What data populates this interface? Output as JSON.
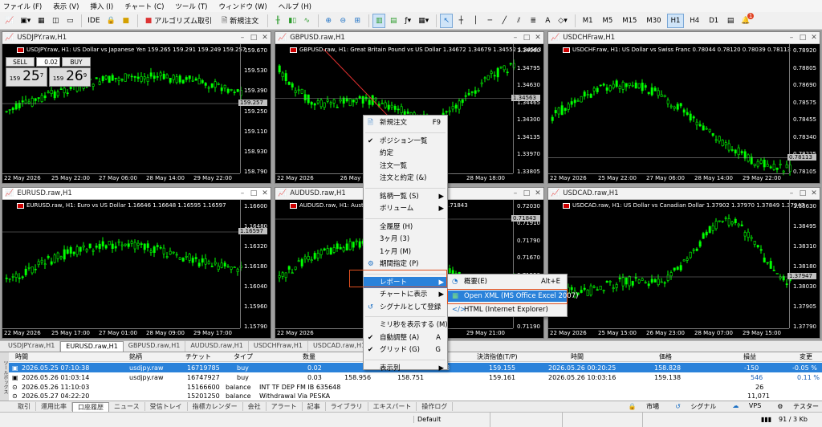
{
  "menu": [
    "ファイル (F)",
    "表示 (V)",
    "挿入 (I)",
    "チャート (C)",
    "ツール (T)",
    "ウィンドウ (W)",
    "ヘルプ (H)"
  ],
  "toolbar": {
    "algo_label": "アルゴリズム取引",
    "neworder_label": "新規注文",
    "ide_label": "IDE",
    "timeframes": [
      "M1",
      "M5",
      "M15",
      "M30",
      "H1",
      "H4",
      "D1"
    ],
    "active_timeframe": "H1",
    "notification_count": "1"
  },
  "charts": [
    {
      "title": "USDJPY.raw,H1",
      "info": "USDJPY.raw, H1:  US Dollar vs Japanese Yen  159.265 159.291 159.249 159.257",
      "prices": [
        "159.670",
        "159.530",
        "159.390",
        "159.250",
        "159.110",
        "158.930",
        "158.790"
      ],
      "label": "159.257",
      "times": [
        "22 May 2026",
        "25 May 22:00",
        "27 May 06:00",
        "28 May 14:00",
        "29 May 22:00"
      ]
    },
    {
      "title": "GBPUSD.raw,H1",
      "info": "GBPUSD.raw, H1:  Great Britain Pound vs US Dollar  1.34672 1.34679 1.34552 1.34563",
      "prices": [
        "1.34960",
        "1.34795",
        "1.34630",
        "1.34465",
        "1.34300",
        "1.34135",
        "1.33970",
        "1.33805"
      ],
      "label": "1.34563",
      "times": [
        "22 May 2026",
        "26 May 02:00",
        "27 May 10:00",
        "28 May 18:00"
      ]
    },
    {
      "title": "USDCHFraw,H1",
      "info": "USDCHF.raw, H1:  US Dollar vs Swiss Franc  0.78044 0.78120 0.78039 0.78113",
      "prices": [
        "0.78920",
        "0.78805",
        "0.78690",
        "0.78575",
        "0.78455",
        "0.78340",
        "0.78225",
        "0.78105"
      ],
      "label": "0.78113",
      "times": [
        "22 May 2026",
        "25 May 22:00",
        "27 May 06:00",
        "28 May 14:00",
        "29 May 22:00"
      ]
    },
    {
      "title": "EURUSD.raw,H1",
      "info": "EURUSD.raw, H1:  Euro vs US Dollar  1.16646 1.16648 1.16595 1.16597",
      "prices": [
        "1.16600",
        "1.16480",
        "1.16320",
        "1.16180",
        "1.16040",
        "1.15960",
        "1.15790"
      ],
      "label": "1.16597",
      "times": [
        "22 May 2026",
        "25 May 17:00",
        "27 May 01:00",
        "28 May 09:00",
        "29 May 17:00"
      ]
    },
    {
      "title": "AUDUSD.raw,H1",
      "info": "AUDUSD.raw, H1:  Austra",
      "info2": "872 0.71826 0.71843",
      "prices": [
        "0.72030",
        "0.71910",
        "0.71790",
        "0.71670",
        "0.71550",
        "0.71430",
        "0.71310",
        "0.71190"
      ],
      "label": "0.71843",
      "times": [
        "22 May 2026",
        "25 May 21:00",
        "29 May 21:00"
      ]
    },
    {
      "title": "USDCAD.raw,H1",
      "info": "USDCAD.raw, H1:  US Dollar vs Canadian Dollar  1.37902 1.37970 1.37849 1.37947",
      "prices": [
        "1.38630",
        "1.38495",
        "1.38310",
        "1.38180",
        "1.38030",
        "1.37905",
        "1.37790"
      ],
      "label": "1.37947",
      "times": [
        "22 May 2026",
        "25 May 15:00",
        "26 May 23:00",
        "28 May 07:00",
        "29 May 15:00"
      ]
    }
  ],
  "oneclick": {
    "sell": "SELL",
    "buy": "BUY",
    "volume": "0.02",
    "bid_main": "25",
    "bid_pre": "159",
    "bid_sup": "7",
    "ask_main": "26",
    "ask_pre": "159",
    "ask_sup": "9"
  },
  "chart_tabs": [
    "USDJPY.raw,H1",
    "EURUSD.raw,H1",
    "GBPUSD.raw,H1",
    "AUDUSD.raw,H1",
    "USDCHFraw,H1",
    "USDCAD.raw,H1"
  ],
  "active_chart_tab": "EURUSD.raw,H1",
  "terminal": {
    "side_label": "ツールボックス",
    "headers": [
      "時間",
      "銘柄",
      "チケット",
      "タイプ",
      "数量",
      "",
      "決済指値(T/P)",
      "時間",
      "価格",
      "損益",
      "変更"
    ],
    "rows": [
      {
        "time": "2026.05.25 07:10:38",
        "symbol": "usdjpy.raw",
        "ticket": "16719785",
        "type": "buy",
        "volume": "0.02",
        "c6": "328",
        "c7": "159.155",
        "c8": "2026.05.26 00:20:25",
        "price": "158.828",
        "pl": "-150",
        "chg": "-0.05 %"
      },
      {
        "time": "2026.05.26 01:03:14",
        "symbol": "usdjpy.raw",
        "ticket": "16747927",
        "type": "buy",
        "volume": "0.03",
        "c5": "158.956",
        "c6": "158.751",
        "c7": "159.161",
        "c8": "2026.05.26 10:03:16",
        "price": "159.138",
        "pl": "546",
        "chg": "0.11 %"
      },
      {
        "time": "2026.05.26 11:10:03",
        "symbol": "",
        "ticket": "15166600",
        "type": "balance",
        "comment": "INT TF DEP FM IB 635648",
        "pl": "26"
      },
      {
        "time": "2026.05.27 04:22:20",
        "symbol": "",
        "ticket": "15201250",
        "type": "balance",
        "comment": "Withdrawal Via PESKA",
        "pl": "11,071"
      }
    ]
  },
  "terminal_tabs": [
    "取引",
    "運用比率",
    "口座履歴",
    "ニュース",
    "受信トレイ",
    "指標カレンダー",
    "会社",
    "アラート",
    "記事",
    "ライブラリ",
    "エキスパート",
    "操作ログ"
  ],
  "active_terminal_tab": "口座履歴",
  "terminal_right": [
    "市場",
    "シグナル",
    "VPS",
    "テスター"
  ],
  "status": {
    "profile": "Default",
    "traffic": "91 / 3 Kb"
  },
  "context_menu": [
    {
      "label": "新規注文",
      "shortcut": "F9",
      "icon": "new-order-icon"
    },
    {
      "sep": true
    },
    {
      "label": "ポジション一覧",
      "check": true
    },
    {
      "label": "約定"
    },
    {
      "label": "注文一覧"
    },
    {
      "label": "注文と約定 (&)"
    },
    {
      "sep": true
    },
    {
      "label": "銘柄一覧 (S)",
      "arrow": true
    },
    {
      "label": "ボリューム",
      "arrow": true
    },
    {
      "sep": true
    },
    {
      "label": "全履歴 (H)"
    },
    {
      "label": "3ヶ月 (3)"
    },
    {
      "label": "1ヶ月 (M)"
    },
    {
      "label": "期間指定 (P)",
      "icon": "gear-icon"
    },
    {
      "sep": true
    },
    {
      "label": "レポート",
      "arrow": true,
      "highlight": true
    },
    {
      "label": "チャートに表示",
      "arrow": true
    },
    {
      "label": "シグナルとして登録",
      "icon": "signal-icon"
    },
    {
      "sep": true
    },
    {
      "label": "ミリ秒を表示する (M)"
    },
    {
      "label": "自動調整 (A)",
      "shortcut": "A",
      "check": true
    },
    {
      "label": "グリッド (G)",
      "shortcut": "G",
      "check": true
    },
    {
      "sep": true
    },
    {
      "label": "表示列",
      "arrow": true
    }
  ],
  "submenu": [
    {
      "label": "概要(E)",
      "shortcut": "Alt+E"
    },
    {
      "label": "Open XML (MS Office Excel 2007)",
      "highlight": true
    },
    {
      "label": "HTML (Internet Explorer)"
    }
  ],
  "colors": {
    "bull": "#00ff00",
    "bear": "#ffffff",
    "highlight": "#2a82da",
    "marker": "#e05020"
  }
}
